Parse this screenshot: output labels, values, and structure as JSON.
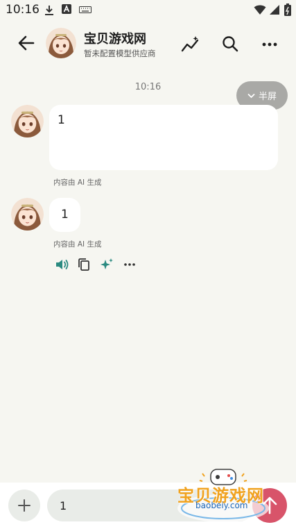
{
  "status_bar": {
    "time": "10:16"
  },
  "header": {
    "title": "宝贝游戏网",
    "subtitle": "暂未配置模型供应商"
  },
  "chat": {
    "timestamp": "10:16",
    "half_screen_label": "半屏",
    "messages": [
      {
        "text": "1",
        "note": "内容由 AI 生成"
      },
      {
        "text": "1",
        "note": "内容由 AI 生成"
      }
    ]
  },
  "input": {
    "value": "1"
  },
  "watermark": {
    "name": "宝贝游戏网",
    "url": "baobeiy.com"
  },
  "colors": {
    "background": "#f6f6f1",
    "accent_teal": "#2a8a80",
    "send_button": "#d8546a"
  }
}
